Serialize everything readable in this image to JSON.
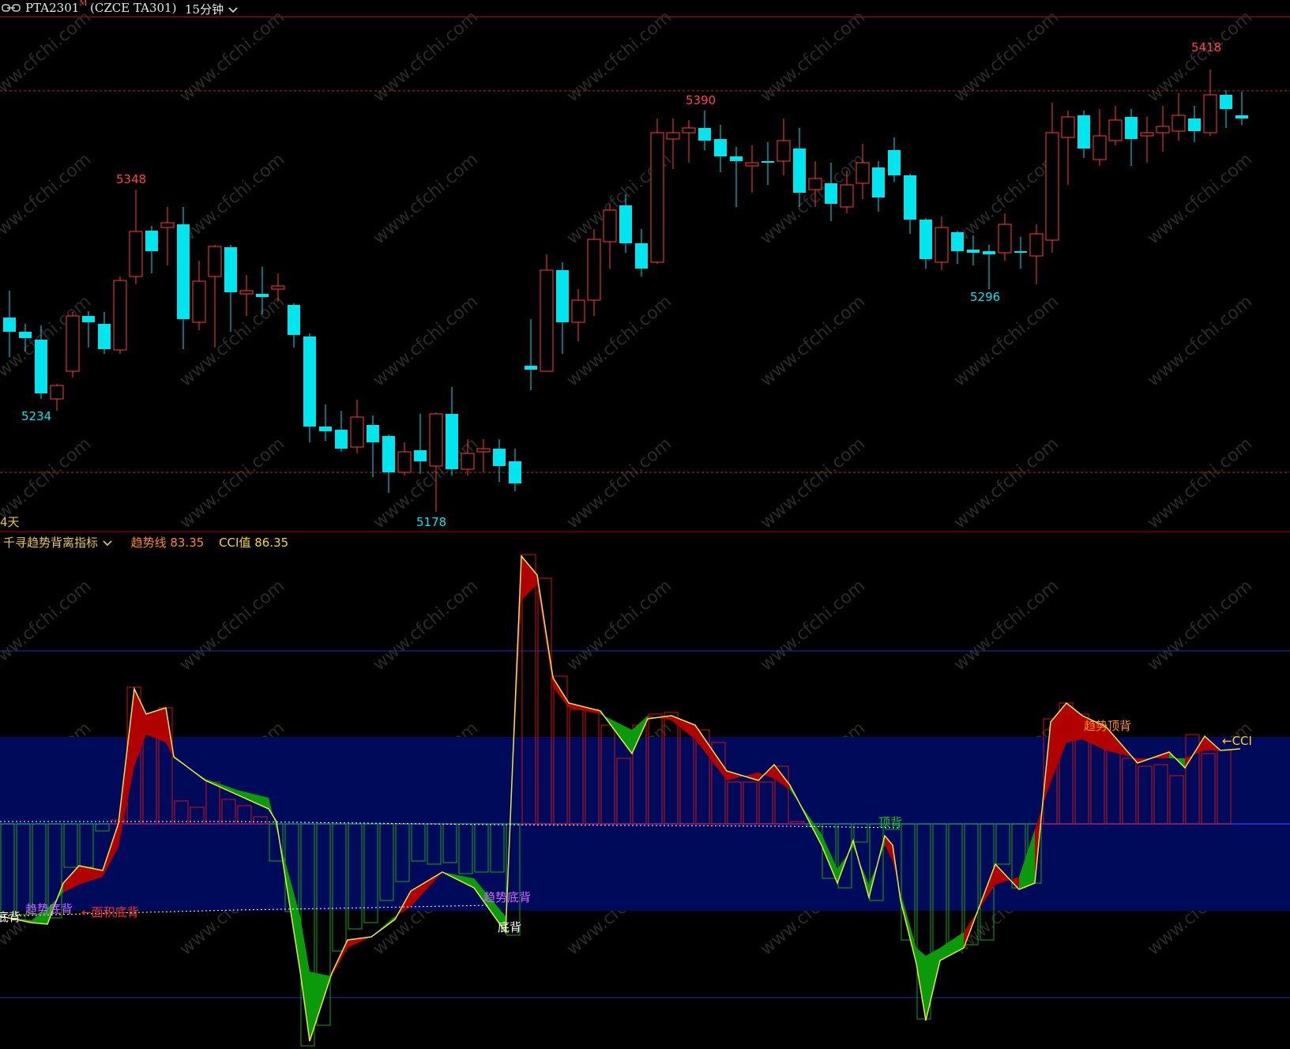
{
  "header": {
    "symbol": "PTA2301",
    "symbol_marker": "M",
    "exchange": "(CZCE TA301)",
    "period": "15分钟",
    "period_chevron_icon": "chevron-down-icon"
  },
  "price_chart": {
    "annotations": {
      "high_1": "5348",
      "low_1": "5234",
      "low_2": "5178",
      "high_2": "5390",
      "low_3": "5296",
      "high_3": "5418"
    },
    "left_note": "4天",
    "colors": {
      "up": "#ff3c3c",
      "down": "#00e5ee",
      "ref_line": "#c02020"
    }
  },
  "indicator": {
    "name": "千寻趋势背离指标",
    "trend_label": "趋势线 83.35",
    "cci_label": "CCI值 86.35",
    "signals": {
      "s1": "底背",
      "s2": "趋势底背",
      "s3": "←面积底背",
      "s4": "趋势底背",
      "s5": "底背",
      "s6": "顶背",
      "s7": "趋势顶背",
      "s8": "←CCI"
    },
    "colors": {
      "band": "#000a5a",
      "bull": "#b00000",
      "bear": "#0a9a0a",
      "line": "#e8e83c"
    }
  },
  "watermark": "www.cfchi.com"
}
